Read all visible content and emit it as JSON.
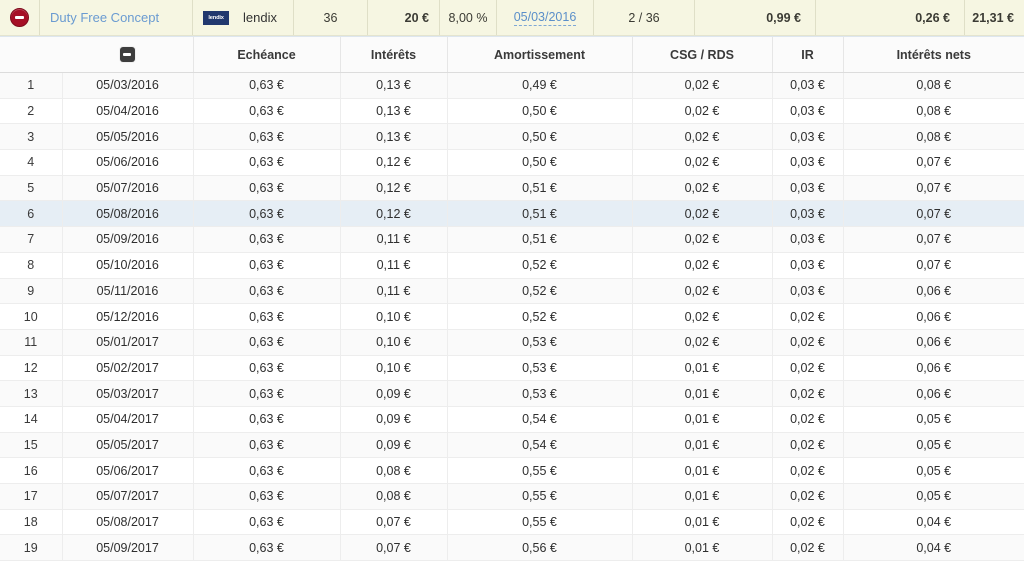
{
  "summary": {
    "remove_icon": "remove-circle-icon",
    "project_name": "Duty Free Concept",
    "platform_logo_text": "lendix",
    "platform_name": "lendix",
    "duration_months": "36",
    "amount": "20 €",
    "rate": "8,00 %",
    "next_date": "05/03/2016",
    "progress": "2 / 36",
    "value_capital": "0,99 €",
    "value_interest": "0,26 €",
    "value_total": "21,31 €",
    "accent_link_color": "#6a9bd1",
    "remove_color": "#a60f26",
    "background_color": "#f6f6e2",
    "logo_color": "#21386e"
  },
  "table": {
    "collapse_icon": "collapse-minus-icon",
    "columns": [
      {
        "key": "idx",
        "label": ""
      },
      {
        "key": "echeance_date",
        "label": ""
      },
      {
        "key": "echeance",
        "label": "Echéance"
      },
      {
        "key": "interets",
        "label": "Intérêts"
      },
      {
        "key": "amortissement",
        "label": "Amortissement"
      },
      {
        "key": "csg_rds",
        "label": "CSG / RDS"
      },
      {
        "key": "ir",
        "label": "IR"
      },
      {
        "key": "interets_nets",
        "label": "Intérêts nets"
      }
    ],
    "hover_row_index": 6,
    "rows": [
      {
        "idx": "1",
        "date": "05/03/2016",
        "echeance": "0,63 €",
        "interets": "0,13 €",
        "amortissement": "0,49 €",
        "csg": "0,02 €",
        "ir": "0,03 €",
        "nets": "0,08 €"
      },
      {
        "idx": "2",
        "date": "05/04/2016",
        "echeance": "0,63 €",
        "interets": "0,13 €",
        "amortissement": "0,50 €",
        "csg": "0,02 €",
        "ir": "0,03 €",
        "nets": "0,08 €"
      },
      {
        "idx": "3",
        "date": "05/05/2016",
        "echeance": "0,63 €",
        "interets": "0,13 €",
        "amortissement": "0,50 €",
        "csg": "0,02 €",
        "ir": "0,03 €",
        "nets": "0,08 €"
      },
      {
        "idx": "4",
        "date": "05/06/2016",
        "echeance": "0,63 €",
        "interets": "0,12 €",
        "amortissement": "0,50 €",
        "csg": "0,02 €",
        "ir": "0,03 €",
        "nets": "0,07 €"
      },
      {
        "idx": "5",
        "date": "05/07/2016",
        "echeance": "0,63 €",
        "interets": "0,12 €",
        "amortissement": "0,51 €",
        "csg": "0,02 €",
        "ir": "0,03 €",
        "nets": "0,07 €"
      },
      {
        "idx": "6",
        "date": "05/08/2016",
        "echeance": "0,63 €",
        "interets": "0,12 €",
        "amortissement": "0,51 €",
        "csg": "0,02 €",
        "ir": "0,03 €",
        "nets": "0,07 €"
      },
      {
        "idx": "7",
        "date": "05/09/2016",
        "echeance": "0,63 €",
        "interets": "0,11 €",
        "amortissement": "0,51 €",
        "csg": "0,02 €",
        "ir": "0,03 €",
        "nets": "0,07 €"
      },
      {
        "idx": "8",
        "date": "05/10/2016",
        "echeance": "0,63 €",
        "interets": "0,11 €",
        "amortissement": "0,52 €",
        "csg": "0,02 €",
        "ir": "0,03 €",
        "nets": "0,07 €"
      },
      {
        "idx": "9",
        "date": "05/11/2016",
        "echeance": "0,63 €",
        "interets": "0,11 €",
        "amortissement": "0,52 €",
        "csg": "0,02 €",
        "ir": "0,03 €",
        "nets": "0,06 €"
      },
      {
        "idx": "10",
        "date": "05/12/2016",
        "echeance": "0,63 €",
        "interets": "0,10 €",
        "amortissement": "0,52 €",
        "csg": "0,02 €",
        "ir": "0,02 €",
        "nets": "0,06 €"
      },
      {
        "idx": "11",
        "date": "05/01/2017",
        "echeance": "0,63 €",
        "interets": "0,10 €",
        "amortissement": "0,53 €",
        "csg": "0,02 €",
        "ir": "0,02 €",
        "nets": "0,06 €"
      },
      {
        "idx": "12",
        "date": "05/02/2017",
        "echeance": "0,63 €",
        "interets": "0,10 €",
        "amortissement": "0,53 €",
        "csg": "0,01 €",
        "ir": "0,02 €",
        "nets": "0,06 €"
      },
      {
        "idx": "13",
        "date": "05/03/2017",
        "echeance": "0,63 €",
        "interets": "0,09 €",
        "amortissement": "0,53 €",
        "csg": "0,01 €",
        "ir": "0,02 €",
        "nets": "0,06 €"
      },
      {
        "idx": "14",
        "date": "05/04/2017",
        "echeance": "0,63 €",
        "interets": "0,09 €",
        "amortissement": "0,54 €",
        "csg": "0,01 €",
        "ir": "0,02 €",
        "nets": "0,05 €"
      },
      {
        "idx": "15",
        "date": "05/05/2017",
        "echeance": "0,63 €",
        "interets": "0,09 €",
        "amortissement": "0,54 €",
        "csg": "0,01 €",
        "ir": "0,02 €",
        "nets": "0,05 €"
      },
      {
        "idx": "16",
        "date": "05/06/2017",
        "echeance": "0,63 €",
        "interets": "0,08 €",
        "amortissement": "0,55 €",
        "csg": "0,01 €",
        "ir": "0,02 €",
        "nets": "0,05 €"
      },
      {
        "idx": "17",
        "date": "05/07/2017",
        "echeance": "0,63 €",
        "interets": "0,08 €",
        "amortissement": "0,55 €",
        "csg": "0,01 €",
        "ir": "0,02 €",
        "nets": "0,05 €"
      },
      {
        "idx": "18",
        "date": "05/08/2017",
        "echeance": "0,63 €",
        "interets": "0,07 €",
        "amortissement": "0,55 €",
        "csg": "0,01 €",
        "ir": "0,02 €",
        "nets": "0,04 €"
      },
      {
        "idx": "19",
        "date": "05/09/2017",
        "echeance": "0,63 €",
        "interets": "0,07 €",
        "amortissement": "0,56 €",
        "csg": "0,01 €",
        "ir": "0,02 €",
        "nets": "0,04 €"
      }
    ]
  }
}
